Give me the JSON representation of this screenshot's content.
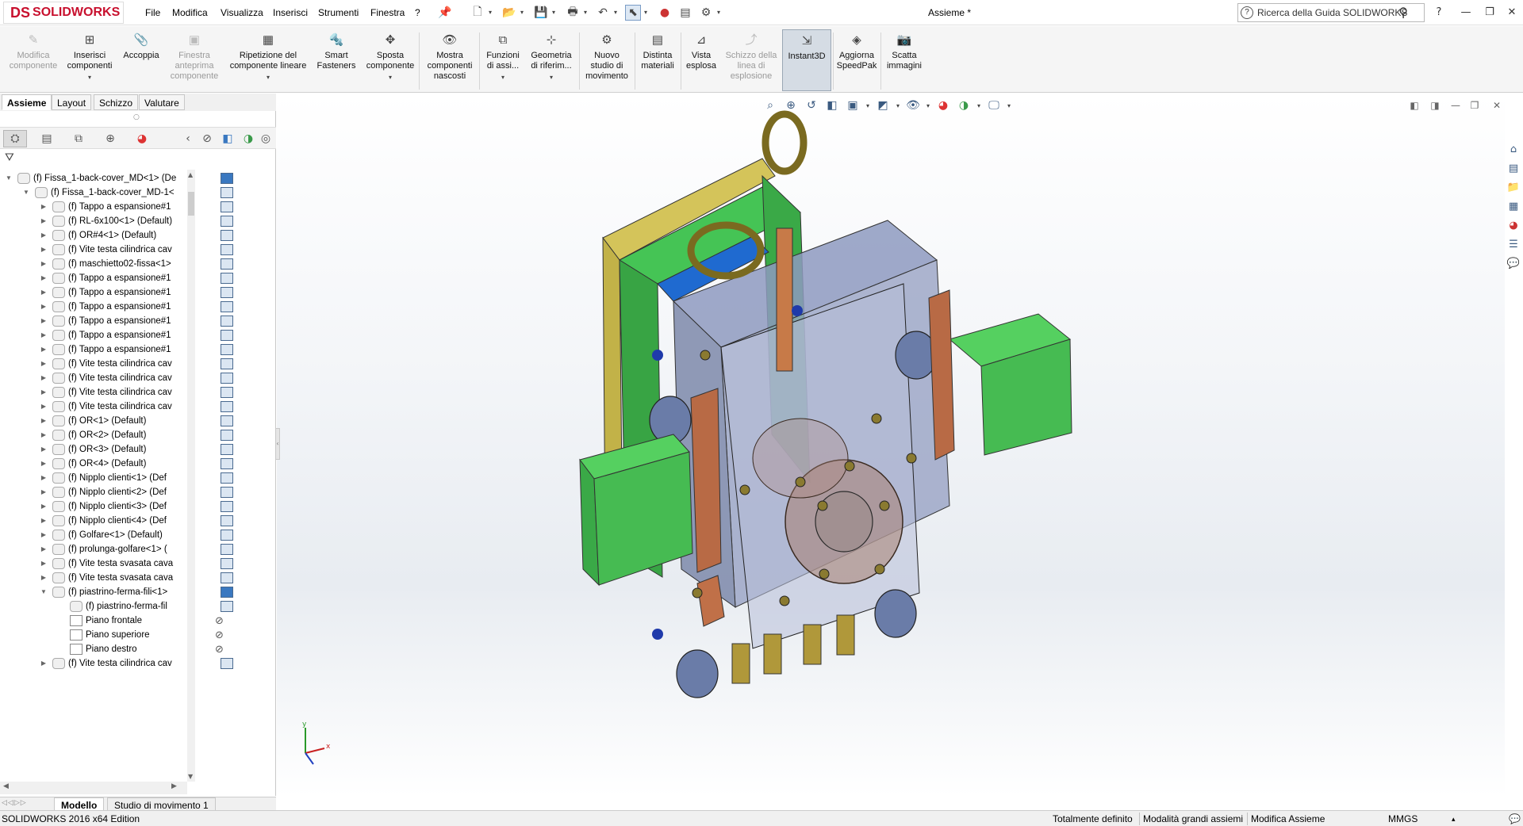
{
  "app": {
    "logo_text": "SOLIDWORKS",
    "logo_mark": "DS",
    "title": "Assieme *",
    "brand_color": "#c8102e"
  },
  "menu": [
    "File",
    "Modifica",
    "Visualizza",
    "Inserisci",
    "Strumenti",
    "Finestra",
    "?"
  ],
  "quick_access_icons": [
    "pin-icon",
    "new-document-icon",
    "open-icon",
    "save-icon",
    "print-icon",
    "undo-icon",
    "select-icon",
    "traffic-light-icon",
    "file-properties-icon",
    "options-icon"
  ],
  "search": {
    "placeholder": "Ricerca della Guida SOLIDWORKS"
  },
  "window_controls": {
    "help": "?",
    "minimize": "—",
    "restore": "❐",
    "close": "✕"
  },
  "ribbon": [
    {
      "label": "Modifica\ncomponente",
      "state": "disabled",
      "icon": "edit-component-icon"
    },
    {
      "label": "Inserisci\ncomponenti",
      "state": "normal",
      "dropdown": true,
      "icon": "insert-components-icon"
    },
    {
      "label": "Accoppia",
      "state": "normal",
      "icon": "mate-icon"
    },
    {
      "label": "Finestra\nanteprima\ncomponente",
      "state": "disabled",
      "icon": "preview-window-icon"
    },
    {
      "label": "Ripetizione del\ncomponente lineare",
      "state": "normal",
      "dropdown": true,
      "icon": "linear-pattern-icon"
    },
    {
      "label": "Smart\nFasteners",
      "state": "normal",
      "icon": "smart-fasteners-icon"
    },
    {
      "label": "Sposta\ncomponente",
      "state": "normal",
      "dropdown": true,
      "icon": "move-component-icon"
    },
    {
      "label": "Mostra\ncomponenti\nnascosti",
      "state": "normal",
      "icon": "show-hidden-icon"
    },
    {
      "label": "Funzioni\ndi assi...",
      "state": "normal",
      "dropdown": true,
      "icon": "assembly-features-icon"
    },
    {
      "label": "Geometria\ndi riferim...",
      "state": "normal",
      "dropdown": true,
      "icon": "reference-geometry-icon"
    },
    {
      "label": "Nuovo\nstudio di\nmovimento",
      "state": "normal",
      "icon": "motion-study-icon"
    },
    {
      "label": "Distinta\nmateriali",
      "state": "normal",
      "icon": "bom-icon"
    },
    {
      "label": "Vista\nesplosa",
      "state": "normal",
      "icon": "exploded-view-icon"
    },
    {
      "label": "Schizzo della\nlinea di\nesplosione",
      "state": "disabled",
      "icon": "explode-line-sketch-icon"
    },
    {
      "label": "Instant3D",
      "state": "active",
      "icon": "instant3d-icon"
    },
    {
      "label": "Aggiorna\nSpeedPak",
      "state": "normal",
      "icon": "speedpak-icon"
    },
    {
      "label": "Scatta\nimmagini",
      "state": "normal",
      "icon": "camera-icon"
    }
  ],
  "command_tabs": [
    "Assieme",
    "Layout",
    "Schizzo",
    "Valutare"
  ],
  "active_command_tab": "Assieme",
  "tree": [
    {
      "label": "(f) Fissa_1-back-cover_MD<1> (De",
      "level": 0,
      "expanded": true,
      "type": "assembly"
    },
    {
      "label": "(f) Fissa_1-back-cover_MD-1<",
      "level": 1,
      "expanded": true,
      "type": "assembly"
    },
    {
      "label": "(f) Tappo a espansione#1",
      "level": 2,
      "type": "part"
    },
    {
      "label": "(f) RL-6x100<1> (Default)",
      "level": 2,
      "type": "part"
    },
    {
      "label": "(f) OR#4<1> (Default)",
      "level": 2,
      "type": "part"
    },
    {
      "label": "(f) Vite testa cilindrica cav",
      "level": 2,
      "type": "part"
    },
    {
      "label": "(f) maschietto02-fissa<1>",
      "level": 2,
      "type": "part"
    },
    {
      "label": "(f) Tappo a espansione#1",
      "level": 2,
      "type": "part"
    },
    {
      "label": "(f) Tappo a espansione#1",
      "level": 2,
      "type": "part"
    },
    {
      "label": "(f) Tappo a espansione#1",
      "level": 2,
      "type": "part"
    },
    {
      "label": "(f) Tappo a espansione#1",
      "level": 2,
      "type": "part"
    },
    {
      "label": "(f) Tappo a espansione#1",
      "level": 2,
      "type": "part"
    },
    {
      "label": "(f) Tappo a espansione#1",
      "level": 2,
      "type": "part"
    },
    {
      "label": "(f) Vite testa cilindrica cav",
      "level": 2,
      "type": "part"
    },
    {
      "label": "(f) Vite testa cilindrica cav",
      "level": 2,
      "type": "part"
    },
    {
      "label": "(f) Vite testa cilindrica cav",
      "level": 2,
      "type": "part"
    },
    {
      "label": "(f) Vite testa cilindrica cav",
      "level": 2,
      "type": "part"
    },
    {
      "label": "(f) OR<1> (Default)",
      "level": 2,
      "type": "part"
    },
    {
      "label": "(f) OR<2> (Default)",
      "level": 2,
      "type": "part"
    },
    {
      "label": "(f) OR<3> (Default)",
      "level": 2,
      "type": "part"
    },
    {
      "label": "(f) OR<4> (Default)",
      "level": 2,
      "type": "part"
    },
    {
      "label": "(f) Nipplo clienti<1> (Def",
      "level": 2,
      "type": "part"
    },
    {
      "label": "(f) Nipplo clienti<2> (Def",
      "level": 2,
      "type": "part"
    },
    {
      "label": "(f) Nipplo clienti<3> (Def",
      "level": 2,
      "type": "part"
    },
    {
      "label": "(f) Nipplo clienti<4> (Def",
      "level": 2,
      "type": "part"
    },
    {
      "label": "(f) Golfare<1> (Default)",
      "level": 2,
      "type": "part"
    },
    {
      "label": "(f) prolunga-golfare<1> (",
      "level": 2,
      "type": "part"
    },
    {
      "label": "(f) Vite testa svasata cava",
      "level": 2,
      "type": "part"
    },
    {
      "label": "(f) Vite testa svasata cava",
      "level": 2,
      "type": "part"
    },
    {
      "label": "(f) piastrino-ferma-fili<1>",
      "level": 2,
      "expanded": true,
      "type": "part"
    },
    {
      "label": "(f) piastrino-ferma-fil",
      "level": 3,
      "type": "part",
      "leaf": true
    },
    {
      "label": "Piano frontale",
      "level": 3,
      "type": "plane",
      "leaf": true
    },
    {
      "label": "Piano superiore",
      "level": 3,
      "type": "plane",
      "leaf": true
    },
    {
      "label": "Piano destro",
      "level": 3,
      "type": "plane",
      "leaf": true
    },
    {
      "label": "(f) Vite testa cilindrica cav",
      "level": 2,
      "type": "part"
    }
  ],
  "bottom_tabs": [
    "Modello",
    "Studio di movimento 1"
  ],
  "active_bottom_tab": "Modello",
  "status": {
    "edition": "SOLIDWORKS 2016 x64 Edition",
    "definition": "Totalmente definito",
    "mode": "Modalità grandi assiemi",
    "editing": "Modifica Assieme",
    "units": "MMGS"
  },
  "colors": {
    "plate_green": "#3fbf4a",
    "plate_yellow": "#c8b84a",
    "transparent_body": "#8a96b8",
    "copper": "#b86a45",
    "brass": "#b0983a"
  }
}
